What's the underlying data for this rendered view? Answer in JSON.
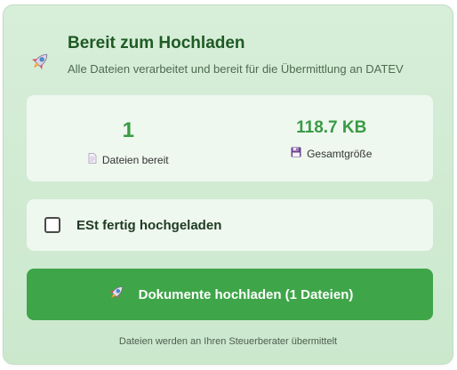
{
  "header": {
    "icon": "rocket-icon",
    "title": "Bereit zum Hochladen",
    "subtitle": "Alle Dateien verarbeitet und bereit für die Übermittlung an DATEV"
  },
  "stats": {
    "files": {
      "value": "1",
      "label": "Dateien bereit",
      "icon": "document-icon"
    },
    "size": {
      "value": "118.7 KB",
      "label": "Gesamtgröße",
      "icon": "floppy-disk-icon"
    }
  },
  "checkbox": {
    "label": "ESt fertig hochgeladen",
    "checked": false
  },
  "upload_button": {
    "label": "Dokumente hochladen (1 Dateien)",
    "icon": "rocket-icon"
  },
  "footer": {
    "text": "Dateien werden an Ihren Steuerberater übermittelt"
  },
  "colors": {
    "accent": "#3fa549",
    "title": "#1f5a24",
    "card_bg": "#d7eed9",
    "panel_bg": "#eef8ef"
  }
}
